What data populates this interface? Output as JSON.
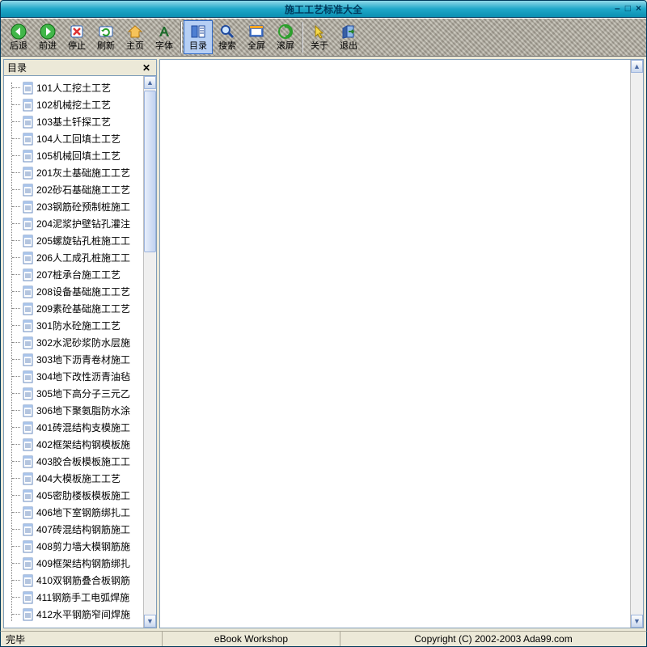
{
  "title": "施工工艺标准大全",
  "toolbar": {
    "back": "后退",
    "forward": "前进",
    "stop": "停止",
    "refresh": "刷新",
    "home": "主页",
    "font": "字体",
    "toc": "目录",
    "search": "搜索",
    "fullscreen": "全屏",
    "scroll": "滚屏",
    "about": "关于",
    "exit": "退出"
  },
  "sidebar": {
    "title": "目录",
    "items": [
      "101人工挖土工艺",
      "102机械挖土工艺",
      "103基土钎探工艺",
      "104人工回填土工艺",
      "105机械回填土工艺",
      "201灰土基础施工工艺",
      "202砂石基础施工工艺",
      "203钢筋砼预制桩施工",
      "204泥浆护壁钻孔灌注",
      "205螺旋钻孔桩施工工",
      "206人工成孔桩施工工",
      "207桩承台施工工艺",
      "208设备基础施工工艺",
      "209素砼基础施工工艺",
      "301防水砼施工工艺",
      "302水泥砂浆防水层施",
      "303地下沥青卷材施工",
      "304地下改性沥青油毡",
      "305地下高分子三元乙",
      "306地下聚氨脂防水涂",
      "401砖混结构支模施工",
      "402框架结构钢模板施",
      "403胶合板模板施工工",
      "404大模板施工工艺",
      "405密肋楼板模板施工",
      "406地下室钢筋绑扎工",
      "407砖混结构钢筋施工",
      "408剪力墙大模钢筋施",
      "409框架结构钢筋绑扎",
      "410双钢筋叠合板钢筋",
      "411钢筋手工电弧焊施",
      "412水平钢筋窄间焊施"
    ]
  },
  "status": {
    "left": "完毕",
    "mid": "eBook Workshop",
    "right": "Copyright (C) 2002-2003 Ada99.com"
  }
}
